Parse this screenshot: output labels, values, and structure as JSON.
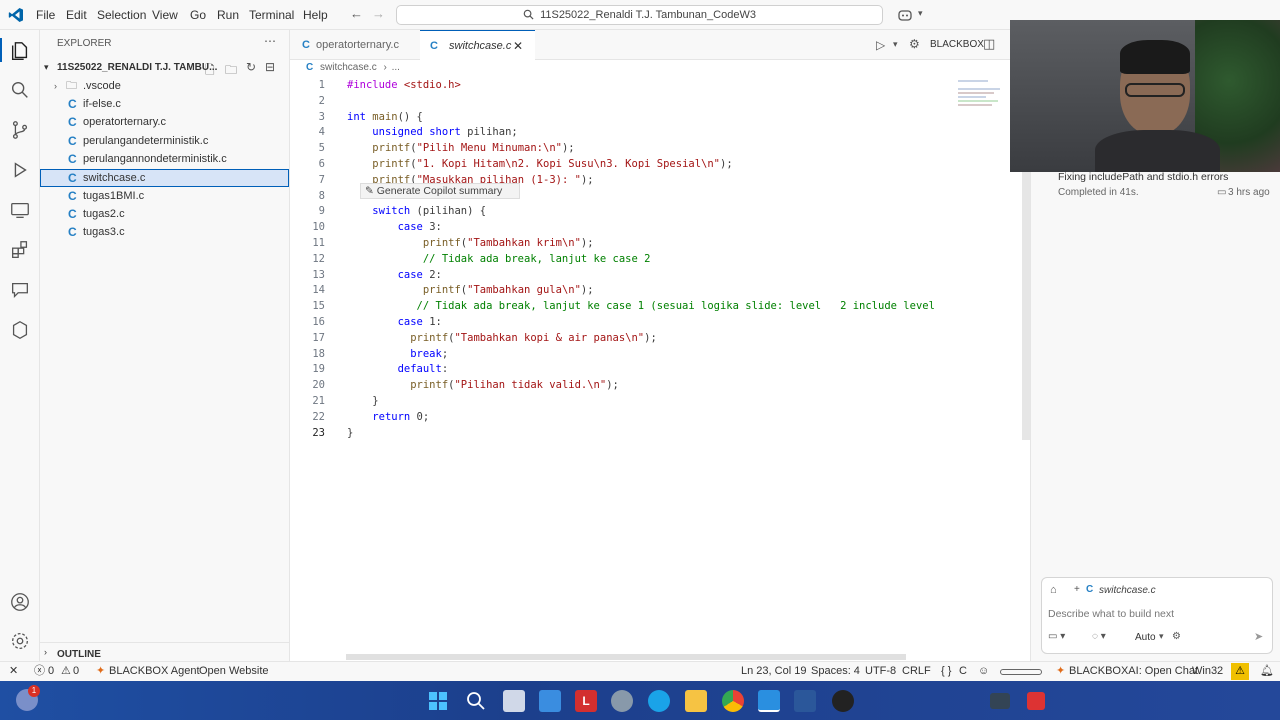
{
  "titlebar": {
    "menus": [
      "File",
      "Edit",
      "Selection",
      "View",
      "Go",
      "Run",
      "Terminal",
      "Help"
    ],
    "search_text": "11S25022_Renaldi T.J. Tambunan_CodeW3"
  },
  "sidebar": {
    "header": "EXPLORER",
    "root": "11S25022_RENALDI T.J. TAMBU...",
    "items": [
      {
        "label": ".vscode",
        "type": "folder"
      },
      {
        "label": "if-else.c",
        "type": "c"
      },
      {
        "label": "operatorternary.c",
        "type": "c"
      },
      {
        "label": "perulangandeterministik.c",
        "type": "c"
      },
      {
        "label": "perulangannondeterministik.c",
        "type": "c"
      },
      {
        "label": "switchcase.c",
        "type": "c"
      },
      {
        "label": "tugas1BMI.c",
        "type": "c"
      },
      {
        "label": "tugas2.c",
        "type": "c"
      },
      {
        "label": "tugas3.c",
        "type": "c"
      }
    ],
    "outline": "OUTLINE"
  },
  "tabs": [
    {
      "label": "operatorternary.c"
    },
    {
      "label": "switchcase.c"
    }
  ],
  "toolbar": {
    "blackbox": "BLACKBOX"
  },
  "breadcrumb": {
    "file": "switchcase.c",
    "more": "..."
  },
  "copilot_hint": "Generate Copilot summary",
  "code": [
    {
      "n": "1",
      "t": "#include <stdio.h>"
    },
    {
      "n": "2",
      "t": ""
    },
    {
      "n": "3",
      "t": "int main() {"
    },
    {
      "n": "4",
      "t": "    unsigned short pilihan;"
    },
    {
      "n": "5",
      "t": "    printf(\"Pilih Menu Minuman:\\n\");"
    },
    {
      "n": "6",
      "t": "    printf(\"1. Kopi Hitam\\n2. Kopi Susu\\n3. Kopi Spesial\\n\");"
    },
    {
      "n": "7",
      "t": "    printf(\"Masukkan pilihan (1-3): \");"
    },
    {
      "n": "8",
      "t": ""
    },
    {
      "n": "9",
      "t": "    switch (pilihan) {"
    },
    {
      "n": "10",
      "t": "        case 3:"
    },
    {
      "n": "11",
      "t": "            printf(\"Tambahkan krim\\n\");"
    },
    {
      "n": "12",
      "t": "            // Tidak ada break, lanjut ke case 2"
    },
    {
      "n": "13",
      "t": "        case 2:"
    },
    {
      "n": "14",
      "t": "            printf(\"Tambahkan gula\\n\");"
    },
    {
      "n": "15",
      "t": "           // Tidak ada break, lanjut ke case 1 (sesuai logika slide: level   2 include level"
    },
    {
      "n": "16",
      "t": "        case 1:"
    },
    {
      "n": "17",
      "t": "          printf(\"Tambahkan kopi & air panas\\n\");"
    },
    {
      "n": "18",
      "t": "          break;"
    },
    {
      "n": "19",
      "t": "        default:"
    },
    {
      "n": "20",
      "t": "          printf(\"Pilihan tidak valid.\\n\");"
    },
    {
      "n": "21",
      "t": "    }"
    },
    {
      "n": "22",
      "t": "    return 0;"
    },
    {
      "n": "23",
      "t": "}"
    }
  ],
  "chat": {
    "history_title": "Fixing includePath and stdio.h errors",
    "history_sub": "Completed in 41s.",
    "history_time": "3 hrs ago",
    "context_file": "switchcase.c",
    "input_placeholder": "Describe what to build next",
    "mode": "Auto"
  },
  "statusbar": {
    "errors": "0",
    "warnings": "0",
    "agent": "BLACKBOX Agent",
    "open_website": "Open Website",
    "position": "Ln 23, Col 19",
    "spaces": "Spaces: 4",
    "encoding": "UTF-8",
    "eol": "CRLF",
    "language": "C",
    "blackbox_chat": "BLACKBOXAI: Open Chat",
    "platform": "Win32"
  },
  "taskbar": {
    "notif_count": "1"
  },
  "colors": {
    "accent": "#005fb8",
    "select_bg": "#d7e4f7",
    "taskbar": "#1f4fa3"
  }
}
